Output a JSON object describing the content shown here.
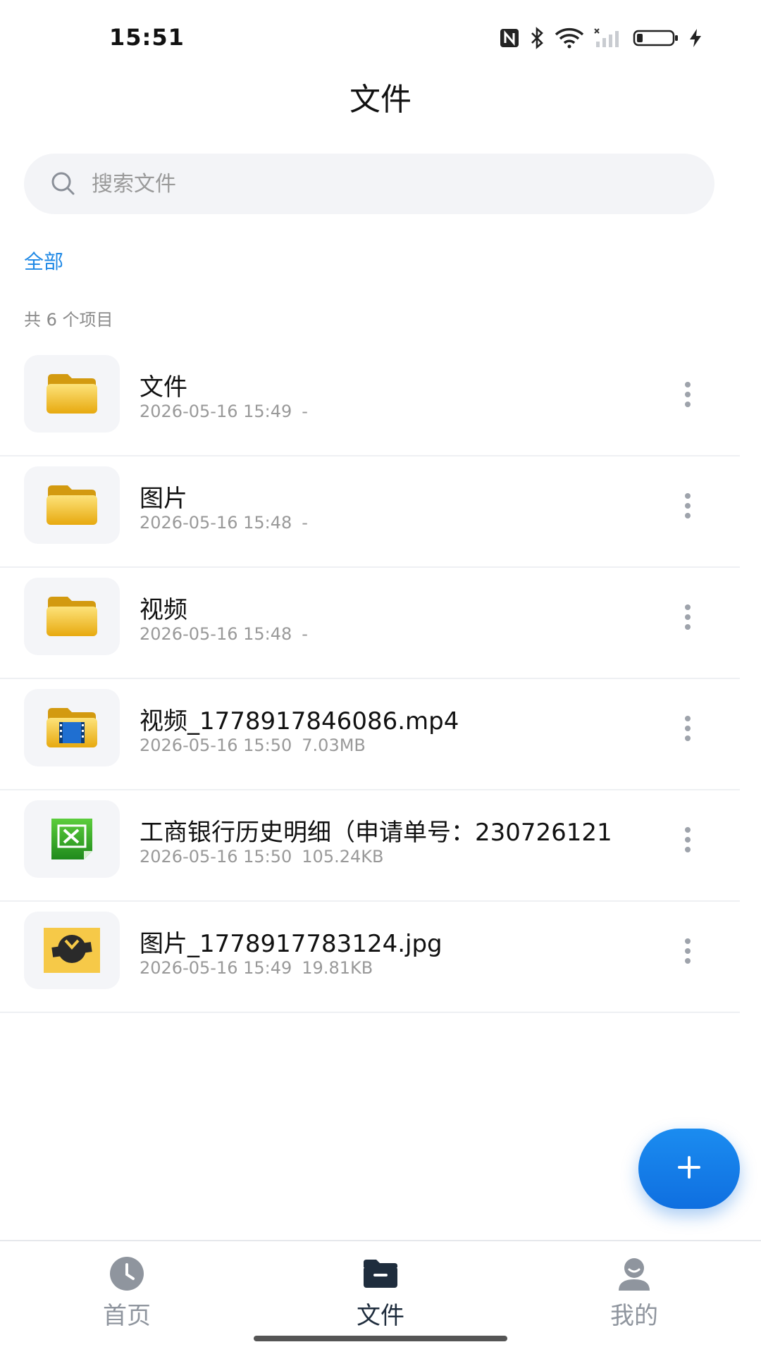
{
  "status_bar": {
    "time": "15:51",
    "icons": [
      "nfc-icon",
      "bluetooth-icon",
      "wifi-icon",
      "signal-icon",
      "battery-icon",
      "charging-icon"
    ]
  },
  "header": {
    "title": "文件"
  },
  "search": {
    "placeholder": "搜索文件",
    "value": ""
  },
  "filter": {
    "active": "全部"
  },
  "list": {
    "count_text": "共 6 个项目",
    "items": [
      {
        "name": "文件",
        "date": "2026-05-16 15:49",
        "size": "-",
        "icon": "folder-icon"
      },
      {
        "name": "图片",
        "date": "2026-05-16 15:48",
        "size": "-",
        "icon": "folder-icon"
      },
      {
        "name": "视频",
        "date": "2026-05-16 15:48",
        "size": "-",
        "icon": "folder-icon"
      },
      {
        "name": "视频_1778917846086.mp4",
        "date": "2026-05-16 15:50",
        "size": "7.03MB",
        "icon": "video-file-icon"
      },
      {
        "name": "工商银行历史明细（申请单号：230726121",
        "date": "2026-05-16 15:50",
        "size": "105.24KB",
        "icon": "excel-file-icon"
      },
      {
        "name": "图片_1778917783124.jpg",
        "date": "2026-05-16 15:49",
        "size": "19.81KB",
        "icon": "image-thumbnail"
      }
    ]
  },
  "fab": {
    "icon": "plus-icon"
  },
  "bottom_nav": {
    "items": [
      {
        "label": "首页",
        "icon": "clock-icon",
        "active": false
      },
      {
        "label": "文件",
        "icon": "folder-tab-icon",
        "active": true
      },
      {
        "label": "我的",
        "icon": "person-icon",
        "active": false
      }
    ]
  },
  "colors": {
    "accent": "#1e88e5",
    "fab": "#1578e8",
    "nav_active": "#1f2d3d",
    "nav_inactive": "#8f959e",
    "folder": "#f2c12e",
    "thumbnail_bg": "#f4f5f8",
    "search_bg": "#f3f4f7"
  }
}
